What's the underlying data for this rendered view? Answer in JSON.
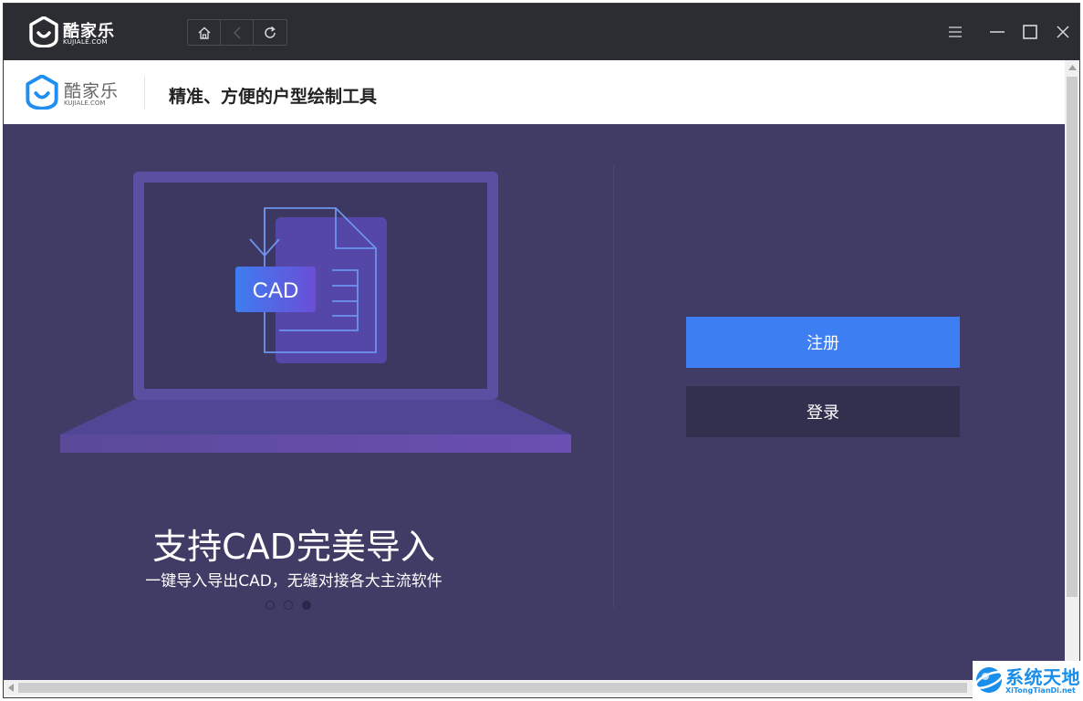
{
  "titlebar": {
    "brand": "酷家乐",
    "brand_sub": "KUJIALE.COM",
    "nav": [
      {
        "icon": "home-icon"
      },
      {
        "icon": "back-icon"
      },
      {
        "icon": "refresh-icon"
      }
    ],
    "controls": [
      {
        "icon": "menu-icon"
      },
      {
        "icon": "minimize-icon"
      },
      {
        "icon": "maximize-icon"
      },
      {
        "icon": "close-icon"
      }
    ]
  },
  "header": {
    "brand": "酷家乐",
    "brand_sub": "KUJIALE.COM",
    "title": "精准、方便的户型绘制工具"
  },
  "slide": {
    "badge": "CAD",
    "title": "支持CAD完美导入",
    "subtitle": "一键导入导出CAD，无缝对接各大主流软件",
    "dots_total": 3,
    "active_dot": 3
  },
  "auth": {
    "register_label": "注册",
    "login_label": "登录"
  },
  "watermark": {
    "main": "系统天地",
    "sub": "XiTongTianDi.net"
  },
  "colors": {
    "titlebar_bg": "#2b2d33",
    "panel_bg": "#403c66",
    "register_bg": "#3d7ef2",
    "login_bg": "#33304f",
    "brand_blue": "#1e8ff0"
  }
}
